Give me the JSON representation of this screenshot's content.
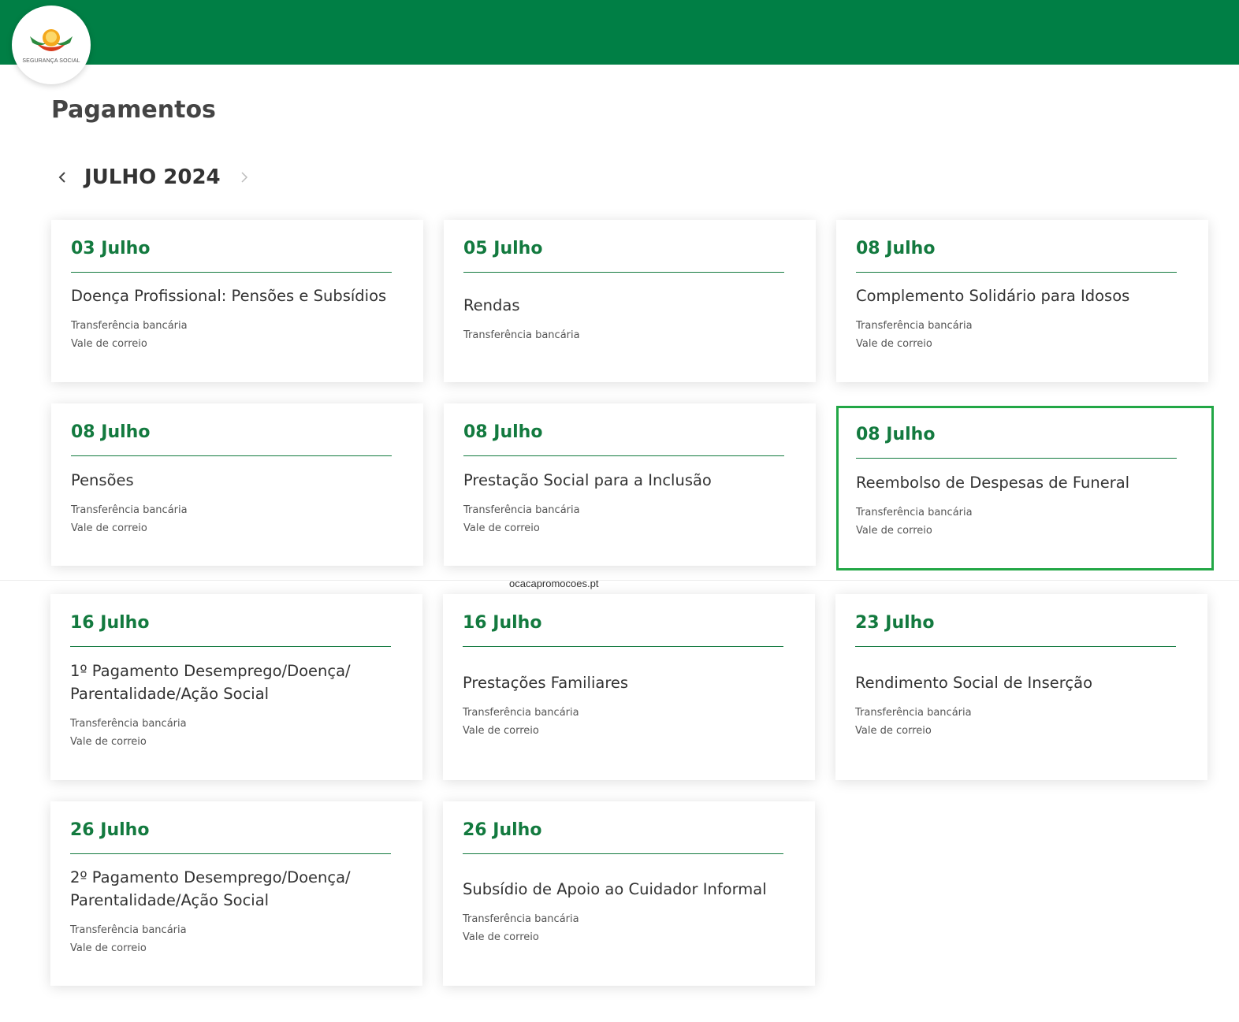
{
  "header": {
    "logo_text": "SEGURANÇA SOCIAL",
    "brand_color": "#007f45"
  },
  "page": {
    "title": "Pagamentos"
  },
  "month_nav": {
    "label": "JULHO 2024",
    "prev_icon": "chevron-left-icon",
    "next_icon": "chevron-right-icon"
  },
  "cards": [
    {
      "date": "03 Julho",
      "title": "Doença Profissional: Pensões e Subsídios",
      "methods": [
        "Transferência bancária",
        "Vale de correio"
      ]
    },
    {
      "date": "05 Julho",
      "title": "Rendas",
      "methods": [
        "Transferência bancária"
      ]
    },
    {
      "date": "08 Julho",
      "title": "Complemento Solidário para Idosos",
      "methods": [
        "Transferência bancária",
        "Vale de correio"
      ]
    },
    {
      "date": "08 Julho",
      "title": "Pensões",
      "methods": [
        "Transferência bancária",
        "Vale de correio"
      ]
    },
    {
      "date": "08 Julho",
      "title": "Prestação Social para a Inclusão",
      "methods": [
        "Transferência bancária",
        "Vale de correio"
      ]
    },
    {
      "date": "08 Julho",
      "title": "Reembolso de Despesas de Funeral",
      "methods": [
        "Transferência bancária",
        "Vale de correio"
      ],
      "highlighted": true
    },
    {
      "date": "16 Julho",
      "title": "1º Pagamento Desemprego/Doença/ Parentalidade/Ação Social",
      "methods": [
        "Transferência bancária",
        "Vale de correio"
      ]
    },
    {
      "date": "16 Julho",
      "title": "Prestações Familiares",
      "methods": [
        "Transferência bancária",
        "Vale de correio"
      ]
    },
    {
      "date": "23 Julho",
      "title": "Rendimento Social de Inserção",
      "methods": [
        "Transferência bancária",
        "Vale de correio"
      ]
    },
    {
      "date": "26 Julho",
      "title": "2º Pagamento Desemprego/Doença/ Parentalidade/Ação Social",
      "methods": [
        "Transferência bancária",
        "Vale de correio"
      ]
    },
    {
      "date": "26 Julho",
      "title": "Subsídio de Apoio ao Cuidador Informal",
      "methods": [
        "Transferência bancária",
        "Vale de correio"
      ]
    }
  ],
  "watermark": "ocacapromocoes.pt",
  "colors": {
    "accent_green": "#137a3f",
    "highlight_border": "#22a746"
  }
}
